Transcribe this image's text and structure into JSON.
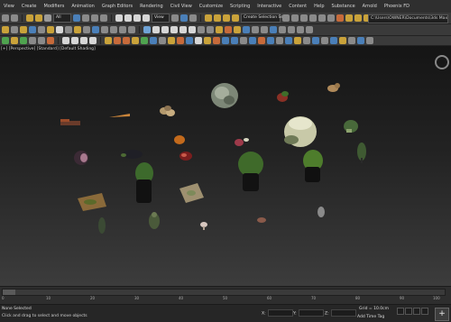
{
  "menu": [
    "View",
    "Create",
    "Modifiers",
    "Animation",
    "Graph Editors",
    "Rendering",
    "Civil View",
    "Customize",
    "Scripting",
    "Interactive",
    "Content",
    "Help",
    "Substance",
    "Arnold",
    "Phoenix FD"
  ],
  "toolbar": {
    "selection_set": "Create Selection Set",
    "path": "C:\\Users\\OWNER\\Documents\\3ds Max"
  },
  "viewport": {
    "label": "[+] [Perspective] [Standard] [Default Shading]"
  },
  "timeline": {
    "ticks": [
      "0",
      "10",
      "20",
      "30",
      "40",
      "50",
      "60",
      "70",
      "80",
      "90",
      "100"
    ]
  },
  "status": {
    "message": "None Selected",
    "hint": "Click and drag to select and move objects",
    "x_label": "X:",
    "y_label": "Y:",
    "z_label": "Z:",
    "grid": "Grid = 10.0cm",
    "add_time_tag": "Add Time Tag",
    "key_icon": "+"
  },
  "colors": {
    "accent": "#4a7fb8",
    "background": "#2b2b2b"
  }
}
